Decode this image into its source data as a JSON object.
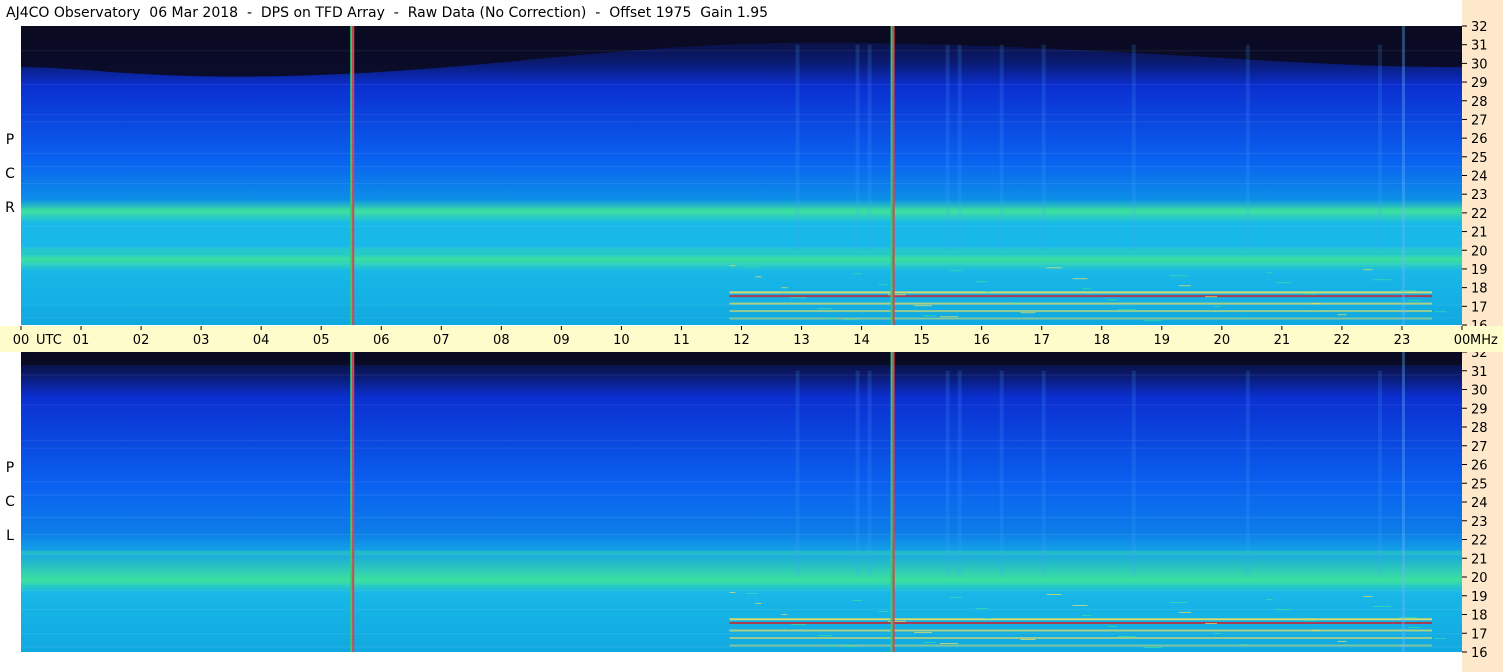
{
  "title": "AJ4CO Observatory  06 Mar 2018  -  DPS on TFD Array  -  Raw Data (No Correction)  -  Offset 1975  Gain 1.95",
  "panels": [
    {
      "id": "rcp",
      "label_letters": [
        "P",
        "C",
        "R"
      ]
    },
    {
      "id": "lcp",
      "label_letters": [
        "P",
        "C",
        "L"
      ]
    }
  ],
  "time_axis": {
    "labels": [
      "00",
      "01",
      "02",
      "03",
      "04",
      "05",
      "06",
      "07",
      "08",
      "09",
      "10",
      "11",
      "12",
      "13",
      "14",
      "15",
      "16",
      "17",
      "18",
      "19",
      "20",
      "21",
      "22",
      "23",
      "00"
    ],
    "unit_left": "UTC",
    "unit_right": "MHz"
  },
  "freq_axis": {
    "labels": [
      "32",
      "31",
      "30",
      "29",
      "28",
      "27",
      "26",
      "25",
      "24",
      "23",
      "22",
      "21",
      "20",
      "19",
      "18",
      "17",
      "16"
    ]
  },
  "colors": {
    "background_dark": "#0a0a20",
    "deep_blue": "#0b2fd0",
    "blue": "#0a62f0",
    "cyan": "#18b8e8",
    "green": "#3be0a0",
    "yellow": "#e8e060",
    "red": "#d02030",
    "axis_bg": "#fffccc",
    "freq_bg": "#fde8cc"
  },
  "chart_data": {
    "type": "heatmap",
    "title": "AJ4CO Observatory  06 Mar 2018  -  DPS on TFD Array  -  Raw Data (No Correction)  -  Offset 1975  Gain 1.95",
    "xlabel": "UTC",
    "ylabel": "MHz",
    "x_range": [
      0,
      24
    ],
    "y_range": [
      16,
      32
    ],
    "panels": [
      "RCP",
      "LCP"
    ],
    "markers_utc": [
      5.5,
      14.5
    ]
  }
}
